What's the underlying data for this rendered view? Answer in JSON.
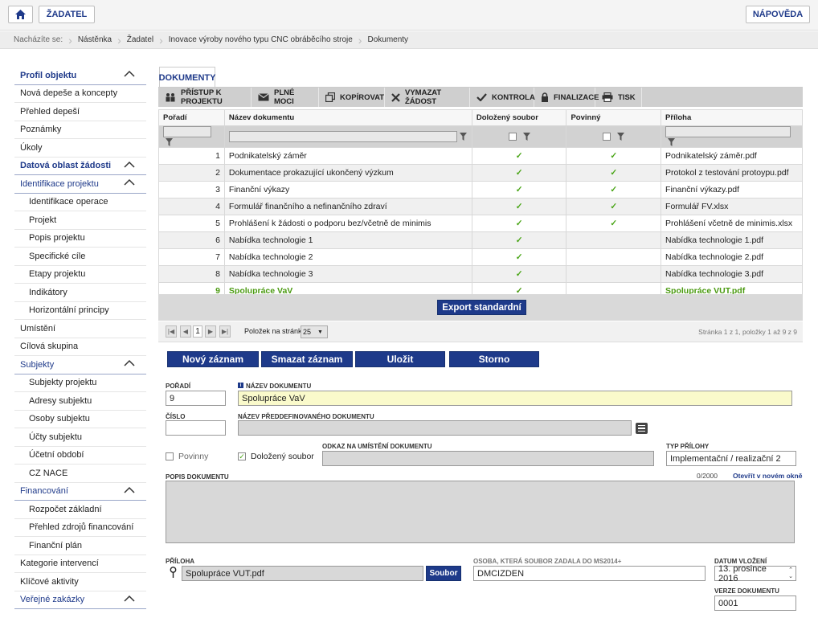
{
  "topbar": {
    "home_icon": "home-icon",
    "applicant_label": "ŽADATEL",
    "help_label": "NÁPOVĚDA"
  },
  "breadcrumb": {
    "prefix": "Nacházíte se:",
    "items": [
      "Nástěnka",
      "Žadatel",
      "Inovace výroby nového typu CNC obráběcího stroje",
      "Dokumenty"
    ]
  },
  "sidebar": {
    "items": [
      {
        "label": "Profil objektu",
        "level": 1,
        "head": true
      },
      {
        "label": "Nová depeše a koncepty",
        "level": 1
      },
      {
        "label": "Přehled depeší",
        "level": 1
      },
      {
        "label": "Poznámky",
        "level": 1
      },
      {
        "label": "Úkoly",
        "level": 1
      },
      {
        "label": "Datová oblast žádosti",
        "level": 1,
        "head": true
      },
      {
        "label": "Identifikace projektu",
        "level": 1,
        "head": true,
        "thin": true
      },
      {
        "label": "Identifikace operace",
        "level": 2
      },
      {
        "label": "Projekt",
        "level": 2
      },
      {
        "label": "Popis projektu",
        "level": 2
      },
      {
        "label": "Specifické cíle",
        "level": 2
      },
      {
        "label": "Etapy projektu",
        "level": 2
      },
      {
        "label": "Indikátory",
        "level": 2
      },
      {
        "label": "Horizontální principy",
        "level": 2
      },
      {
        "label": "Umístění",
        "level": 1
      },
      {
        "label": "Cílová skupina",
        "level": 1
      },
      {
        "label": "Subjekty",
        "level": 1,
        "head": true,
        "thin": true
      },
      {
        "label": "Subjekty projektu",
        "level": 2
      },
      {
        "label": "Adresy subjektu",
        "level": 2
      },
      {
        "label": "Osoby subjektu",
        "level": 2
      },
      {
        "label": "Účty subjektu",
        "level": 2
      },
      {
        "label": "Účetní období",
        "level": 2
      },
      {
        "label": "CZ NACE",
        "level": 2
      },
      {
        "label": "Financování",
        "level": 1,
        "head": true,
        "thin": true
      },
      {
        "label": "Rozpočet základní",
        "level": 2
      },
      {
        "label": "Přehled zdrojů financování",
        "level": 2
      },
      {
        "label": "Finanční plán",
        "level": 2
      },
      {
        "label": "Kategorie intervencí",
        "level": 1
      },
      {
        "label": "Klíčové aktivity",
        "level": 1
      },
      {
        "label": "Veřejné zakázky",
        "level": 1,
        "head": true,
        "thin": true
      }
    ]
  },
  "tab": {
    "label": "DOKUMENTY"
  },
  "toolbar": [
    {
      "label": "PŘÍSTUP K PROJEKTU",
      "icon": "people-icon"
    },
    {
      "label": "PLNÉ MOCI",
      "icon": "envelope-icon"
    },
    {
      "label": "KOPÍROVAT",
      "icon": "copy-icon"
    },
    {
      "label": "VYMAZAT ŽÁDOST",
      "icon": "close-icon"
    },
    {
      "label": "KONTROLA",
      "icon": "check-icon"
    },
    {
      "label": "FINALIZACE",
      "icon": "lock-icon"
    },
    {
      "label": "TISK",
      "icon": "printer-icon"
    }
  ],
  "grid": {
    "columns": [
      "Pořadí",
      "Název dokumentu",
      "Doložený soubor",
      "Povinný",
      "Příloha"
    ],
    "rows": [
      {
        "n": "1",
        "name": "Podnikatelský záměr",
        "file": true,
        "req": true,
        "att": "Podnikatelský záměr.pdf"
      },
      {
        "n": "2",
        "name": "Dokumentace prokazující ukončený výzkum",
        "file": true,
        "req": true,
        "att": "Protokol z testování protoypu.pdf"
      },
      {
        "n": "3",
        "name": "Finanční výkazy",
        "file": true,
        "req": true,
        "att": "Finanční výkazy.pdf"
      },
      {
        "n": "4",
        "name": "Formulář finančního a nefinančního zdraví",
        "file": true,
        "req": true,
        "att": "Formulář FV.xlsx"
      },
      {
        "n": "5",
        "name": "Prohlášení k žádosti o podporu bez/včetně de minimis",
        "file": true,
        "req": true,
        "att": "Prohlášení včetně de minimis.xlsx"
      },
      {
        "n": "6",
        "name": "Nabídka technologie 1",
        "file": true,
        "req": false,
        "att": "Nabídka technologie 1.pdf"
      },
      {
        "n": "7",
        "name": "Nabídka technologie 2",
        "file": true,
        "req": false,
        "att": "Nabídka technologie 2.pdf"
      },
      {
        "n": "8",
        "name": "Nabídka technologie 3",
        "file": true,
        "req": false,
        "att": "Nabídka technologie 3.pdf"
      },
      {
        "n": "9",
        "name": "Spolupráce VaV",
        "file": true,
        "req": false,
        "att": "Spolupráce VUT.pdf"
      }
    ],
    "check_glyph": "✓",
    "export_label": "Export standardní"
  },
  "pager": {
    "page": "1",
    "per_page_label": "Položek na stránku",
    "per_page": "25",
    "info": "Stránka 1 z 1, položky 1 až 9 z 9"
  },
  "actions": {
    "new": "Nový záznam",
    "delete": "Smazat záznam",
    "save": "Uložit",
    "cancel": "Storno"
  },
  "form": {
    "poradi_label": "POŘADÍ",
    "poradi": "9",
    "nazev_label": "NÁZEV DOKUMENTU",
    "nazev": "Spolupráce VaV",
    "cislo_label": "ČÍSLO",
    "cislo": "",
    "predef_label": "NÁZEV PŘEDDEFINOVANÉHO DOKUMENTU",
    "predef": "",
    "povinny_label": "Povinny",
    "dolozeny_label": "Doložený soubor",
    "odkaz_label": "ODKAZ NA UMÍSTĚNÍ DOKUMENTU",
    "odkaz": "",
    "typ_label": "TYP PŘÍLOHY",
    "typ": "Implementační / realizační 2",
    "popis_label": "POPIS DOKUMENTU",
    "popis_count": "0/2000",
    "open_link": "Otevřít v novém okně",
    "priloha_label": "PŘÍLOHA",
    "priloha": "Spolupráce VUT.pdf",
    "soubor_btn": "Soubor",
    "osoba_label": "OSOBA, KTERÁ SOUBOR ZADALA DO MS2014+",
    "osoba": "DMCIZDEN",
    "datum_label": "DATUM VLOŽENÍ",
    "datum": "13. prosince 2016",
    "verze_label": "VERZE DOKUMENTU",
    "verze": "0001"
  }
}
